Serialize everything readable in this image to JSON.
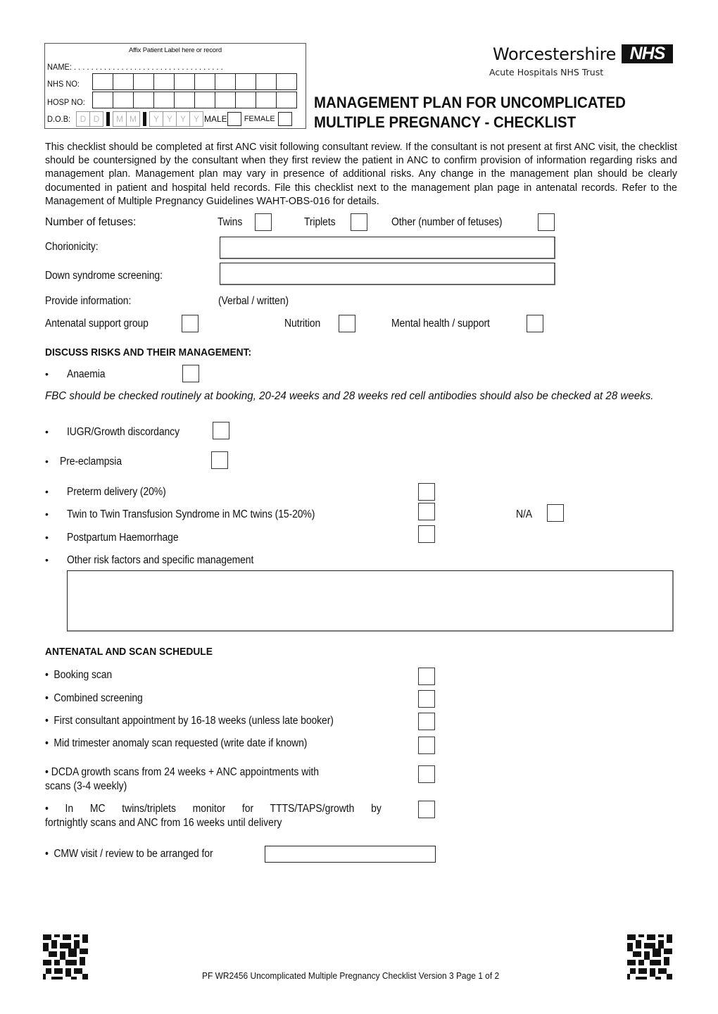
{
  "patient_label": {
    "header": "Affix Patient Label here or record",
    "name_label": "NAME:",
    "name_dots": ". . . . . . . . . . . . . . . . . . . . . . . . . . . . . . . . . . .",
    "nhs_label": "NHS NO:",
    "hosp_label": "HOSP NO:",
    "dob_label": "D.O.B:",
    "dob_placeholders": [
      "D",
      "D",
      "M",
      "M",
      "Y",
      "Y",
      "Y",
      "Y"
    ],
    "male_label": "MALE",
    "female_label": "FEMALE"
  },
  "logo": {
    "org_name": "Worcestershire",
    "nhs_badge": "NHS",
    "trust_name": "Acute Hospitals NHS Trust"
  },
  "title": {
    "line1": "MANAGEMENT PLAN FOR UNCOMPLICATED",
    "line2": "MULTIPLE PREGNANCY - CHECKLIST"
  },
  "intro": "This checklist should be completed at first ANC visit following consultant review. If the consultant is not present at first ANC visit, the checklist should be countersigned by the consultant when they first review the patient in ANC to confirm provision of information regarding risks and management plan. Management plan may vary in presence of additional risks. Any change in the management plan should be clearly documented in patient and hospital held records.  File this checklist next to the management plan page in antenatal records. Refer to the Management of Multiple Pregnancy Guidelines WAHT-OBS-016 for details.",
  "fetuses": {
    "label": "Number of fetuses:",
    "twins": "Twins",
    "triplets": "Triplets",
    "other": "Other (number of fetuses)"
  },
  "chorionicity_label": "Chorionicity:",
  "down_syndrome_label": "Down syndrome screening:",
  "provide_info": {
    "label": "Provide information:",
    "mode": "(Verbal / written)"
  },
  "support": {
    "antenatal_group": "Antenatal support group",
    "nutrition": "Nutrition",
    "mental_health": "Mental health / support"
  },
  "risks": {
    "heading": "DISCUSS RISKS AND THEIR MANAGEMENT:",
    "anaemia": "Anaemia",
    "fbc_note": "FBC should be checked routinely at booking, 20-24 weeks and 28 weeks red cell antibodies should also be checked at 28 weeks.",
    "iugr": "IUGR/Growth discordancy",
    "pre_eclampsia": "Pre-eclampsia",
    "preterm": "Preterm delivery (20%)",
    "ttts": "Twin to Twin Transfusion Syndrome in MC twins (15-20%)",
    "na_label": "N/A",
    "pph": "Postpartum Haemorrhage",
    "other": "Other risk factors and specific management"
  },
  "schedule": {
    "heading": "ANTENATAL AND SCAN SCHEDULE",
    "items": [
      "Booking scan",
      "Combined screening",
      "First consultant appointment by 16-18 weeks (unless late booker)",
      "Mid trimester anomaly scan requested (write date if known)"
    ],
    "dcda_line1": "• DCDA growth scans from 24 weeks + ANC appointments with",
    "dcda_line2": "scans (3-4 weekly)",
    "mc_line1": "• In MC twins/triplets monitor for TTTS/TAPS/growth by",
    "mc_line2": "fortnightly scans and ANC from 16 weeks until delivery",
    "cmw": "CMW visit / review to be arranged for"
  },
  "bullet_char": "•",
  "footer": "PF WR2456 Uncomplicated Multiple Pregnancy Checklist Version 3 Page 1 of 2"
}
